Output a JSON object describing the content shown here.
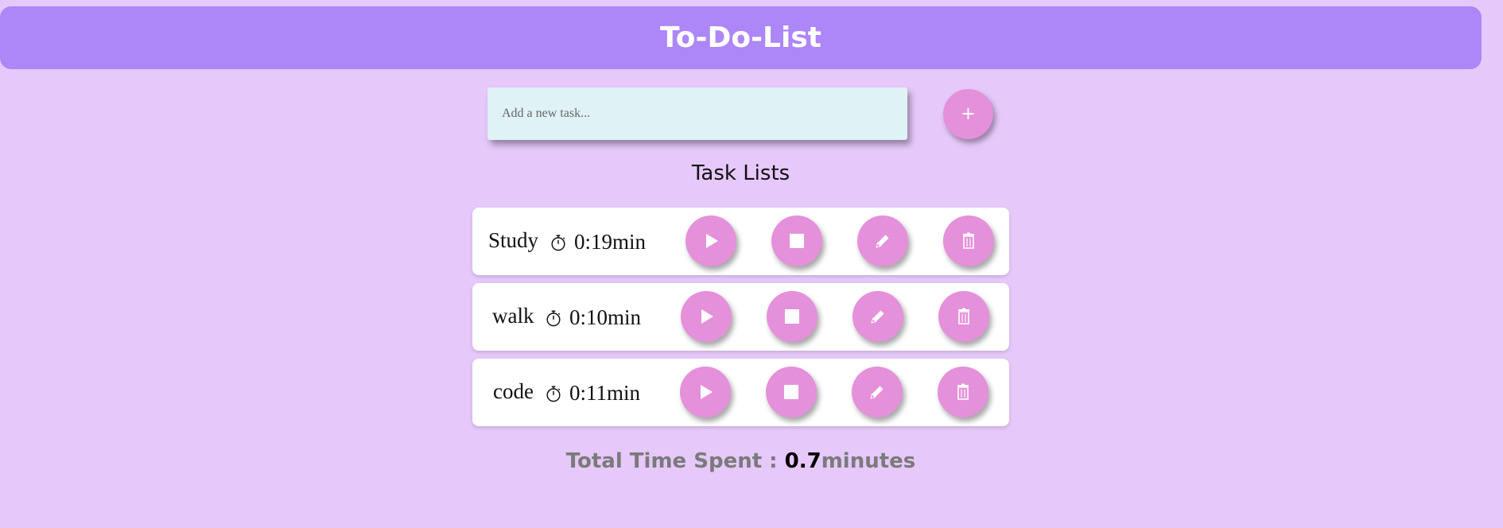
{
  "header": {
    "title": "To-Do-List"
  },
  "input": {
    "placeholder": "Add a new task..."
  },
  "add_button": {
    "label": "+"
  },
  "section_title": "Task Lists",
  "tasks": [
    {
      "name": "Study",
      "time": "0:19min"
    },
    {
      "name": "walk",
      "time": "0:10min"
    },
    {
      "name": "code",
      "time": "0:11min"
    }
  ],
  "total": {
    "label": "Total Time Spent : ",
    "value": "0.7",
    "unit": "minutes"
  },
  "colors": {
    "background": "#e6c8fa",
    "header": "#ad86f7",
    "button": "#e590da",
    "input": "#dff2f6"
  },
  "icons": {
    "play": "play-icon",
    "stop": "stop-icon",
    "edit": "pencil-icon",
    "delete": "trash-icon",
    "timer": "stopwatch-icon"
  }
}
